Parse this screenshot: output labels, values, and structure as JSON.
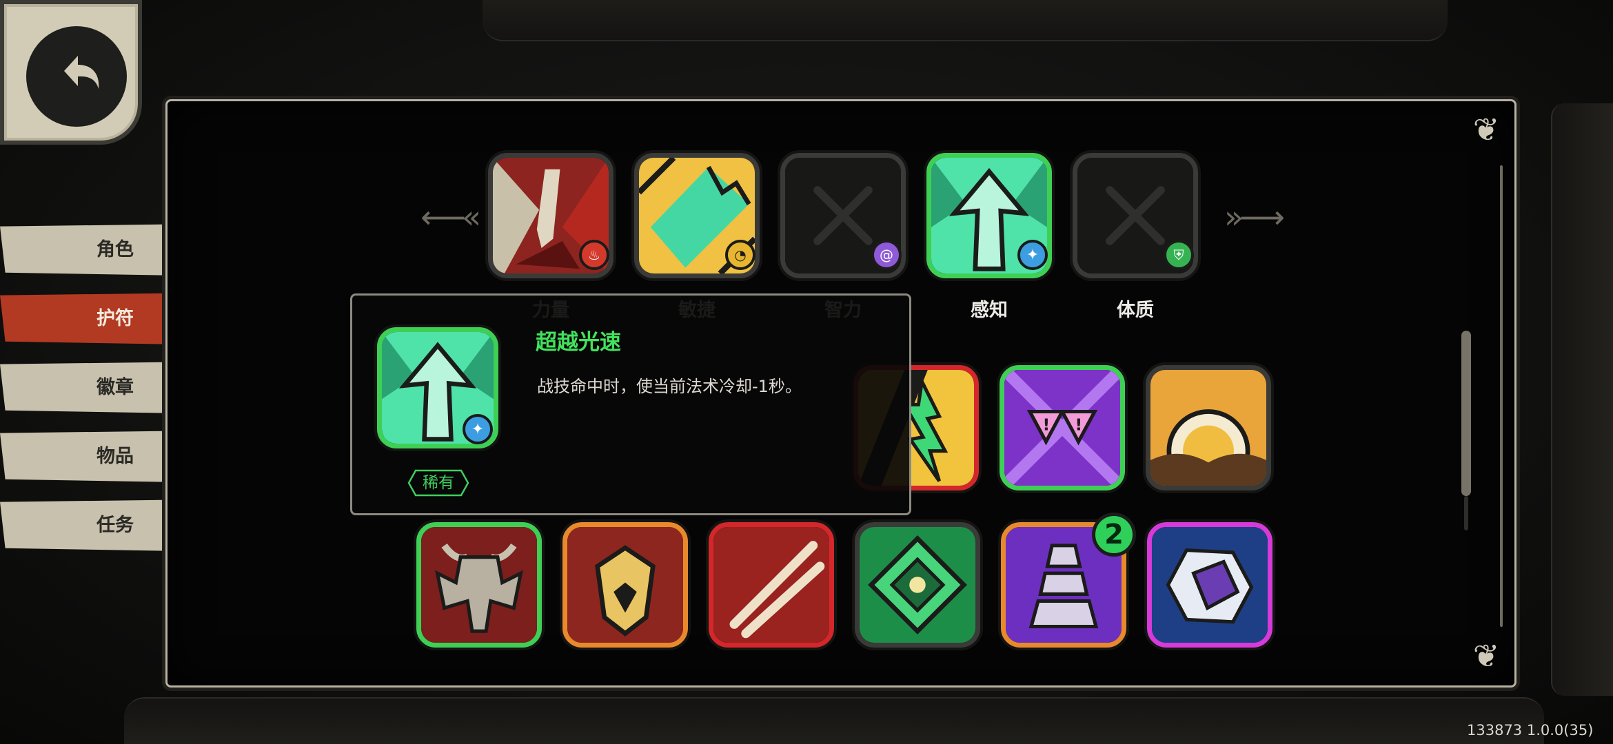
{
  "menu": {
    "items": [
      {
        "label": "角色"
      },
      {
        "label": "护符"
      },
      {
        "label": "徽章"
      },
      {
        "label": "物品"
      },
      {
        "label": "任务"
      }
    ],
    "active_index": 1
  },
  "slots": [
    {
      "label": "力量",
      "icon": "blood-spike-charm-icon",
      "badge": "flame-icon",
      "badge_color": "#d33a2b",
      "border": "#3a3a38"
    },
    {
      "label": "敏捷",
      "icon": "golden-shards-charm-icon",
      "badge": "pacman-icon",
      "badge_color": "#e8b530",
      "border": "#3a3a38"
    },
    {
      "label": "智力",
      "icon": "empty-slot-x-icon",
      "badge": "spiral-icon",
      "badge_color": "#8e5ad8",
      "border": "#3a3a38"
    },
    {
      "label": "感知",
      "icon": "ascending-arrow-charm-icon",
      "badge": "sparkle-icon",
      "badge_color": "#3c9ee0",
      "border": "#3ed055"
    },
    {
      "label": "体质",
      "icon": "empty-slot-x-icon",
      "badge": "shield-icon",
      "badge_color": "#35b352",
      "border": "#3a3a38"
    }
  ],
  "tooltip": {
    "title": "超越光速",
    "description": "战技命中时，使当前法术冷却-1秒。",
    "rarity": "稀有",
    "title_color": "#43e25c"
  },
  "inventory_row1": [
    {
      "icon": "lightning-arrow-charm-icon",
      "border": "#d4272b"
    },
    {
      "icon": "alert-triangles-charm-icon",
      "border": "#3ed055"
    },
    {
      "icon": "sunrise-charm-icon",
      "border": "#3a3a38"
    }
  ],
  "inventory_row2": [
    {
      "icon": "demon-skull-charm-icon",
      "border": "#3ed055"
    },
    {
      "icon": "golden-helmet-charm-icon",
      "border": "#e88a2c"
    },
    {
      "icon": "claw-slash-charm-icon",
      "border": "#d4272b"
    },
    {
      "icon": "emerald-eye-charm-icon",
      "border": "#3a3a38"
    },
    {
      "icon": "purple-staircase-charm-icon",
      "border": "#e88a2c",
      "count": "2"
    },
    {
      "icon": "crystal-geode-charm-icon",
      "border": "#d63ad9"
    }
  ],
  "version": "133873 1.0.0(35)",
  "icons": {
    "back": "back-arrow-icon",
    "left_arrow": "left-arrow-icon",
    "right_arrow": "right-arrow-icon",
    "corner": "corner-ornament-icon"
  }
}
